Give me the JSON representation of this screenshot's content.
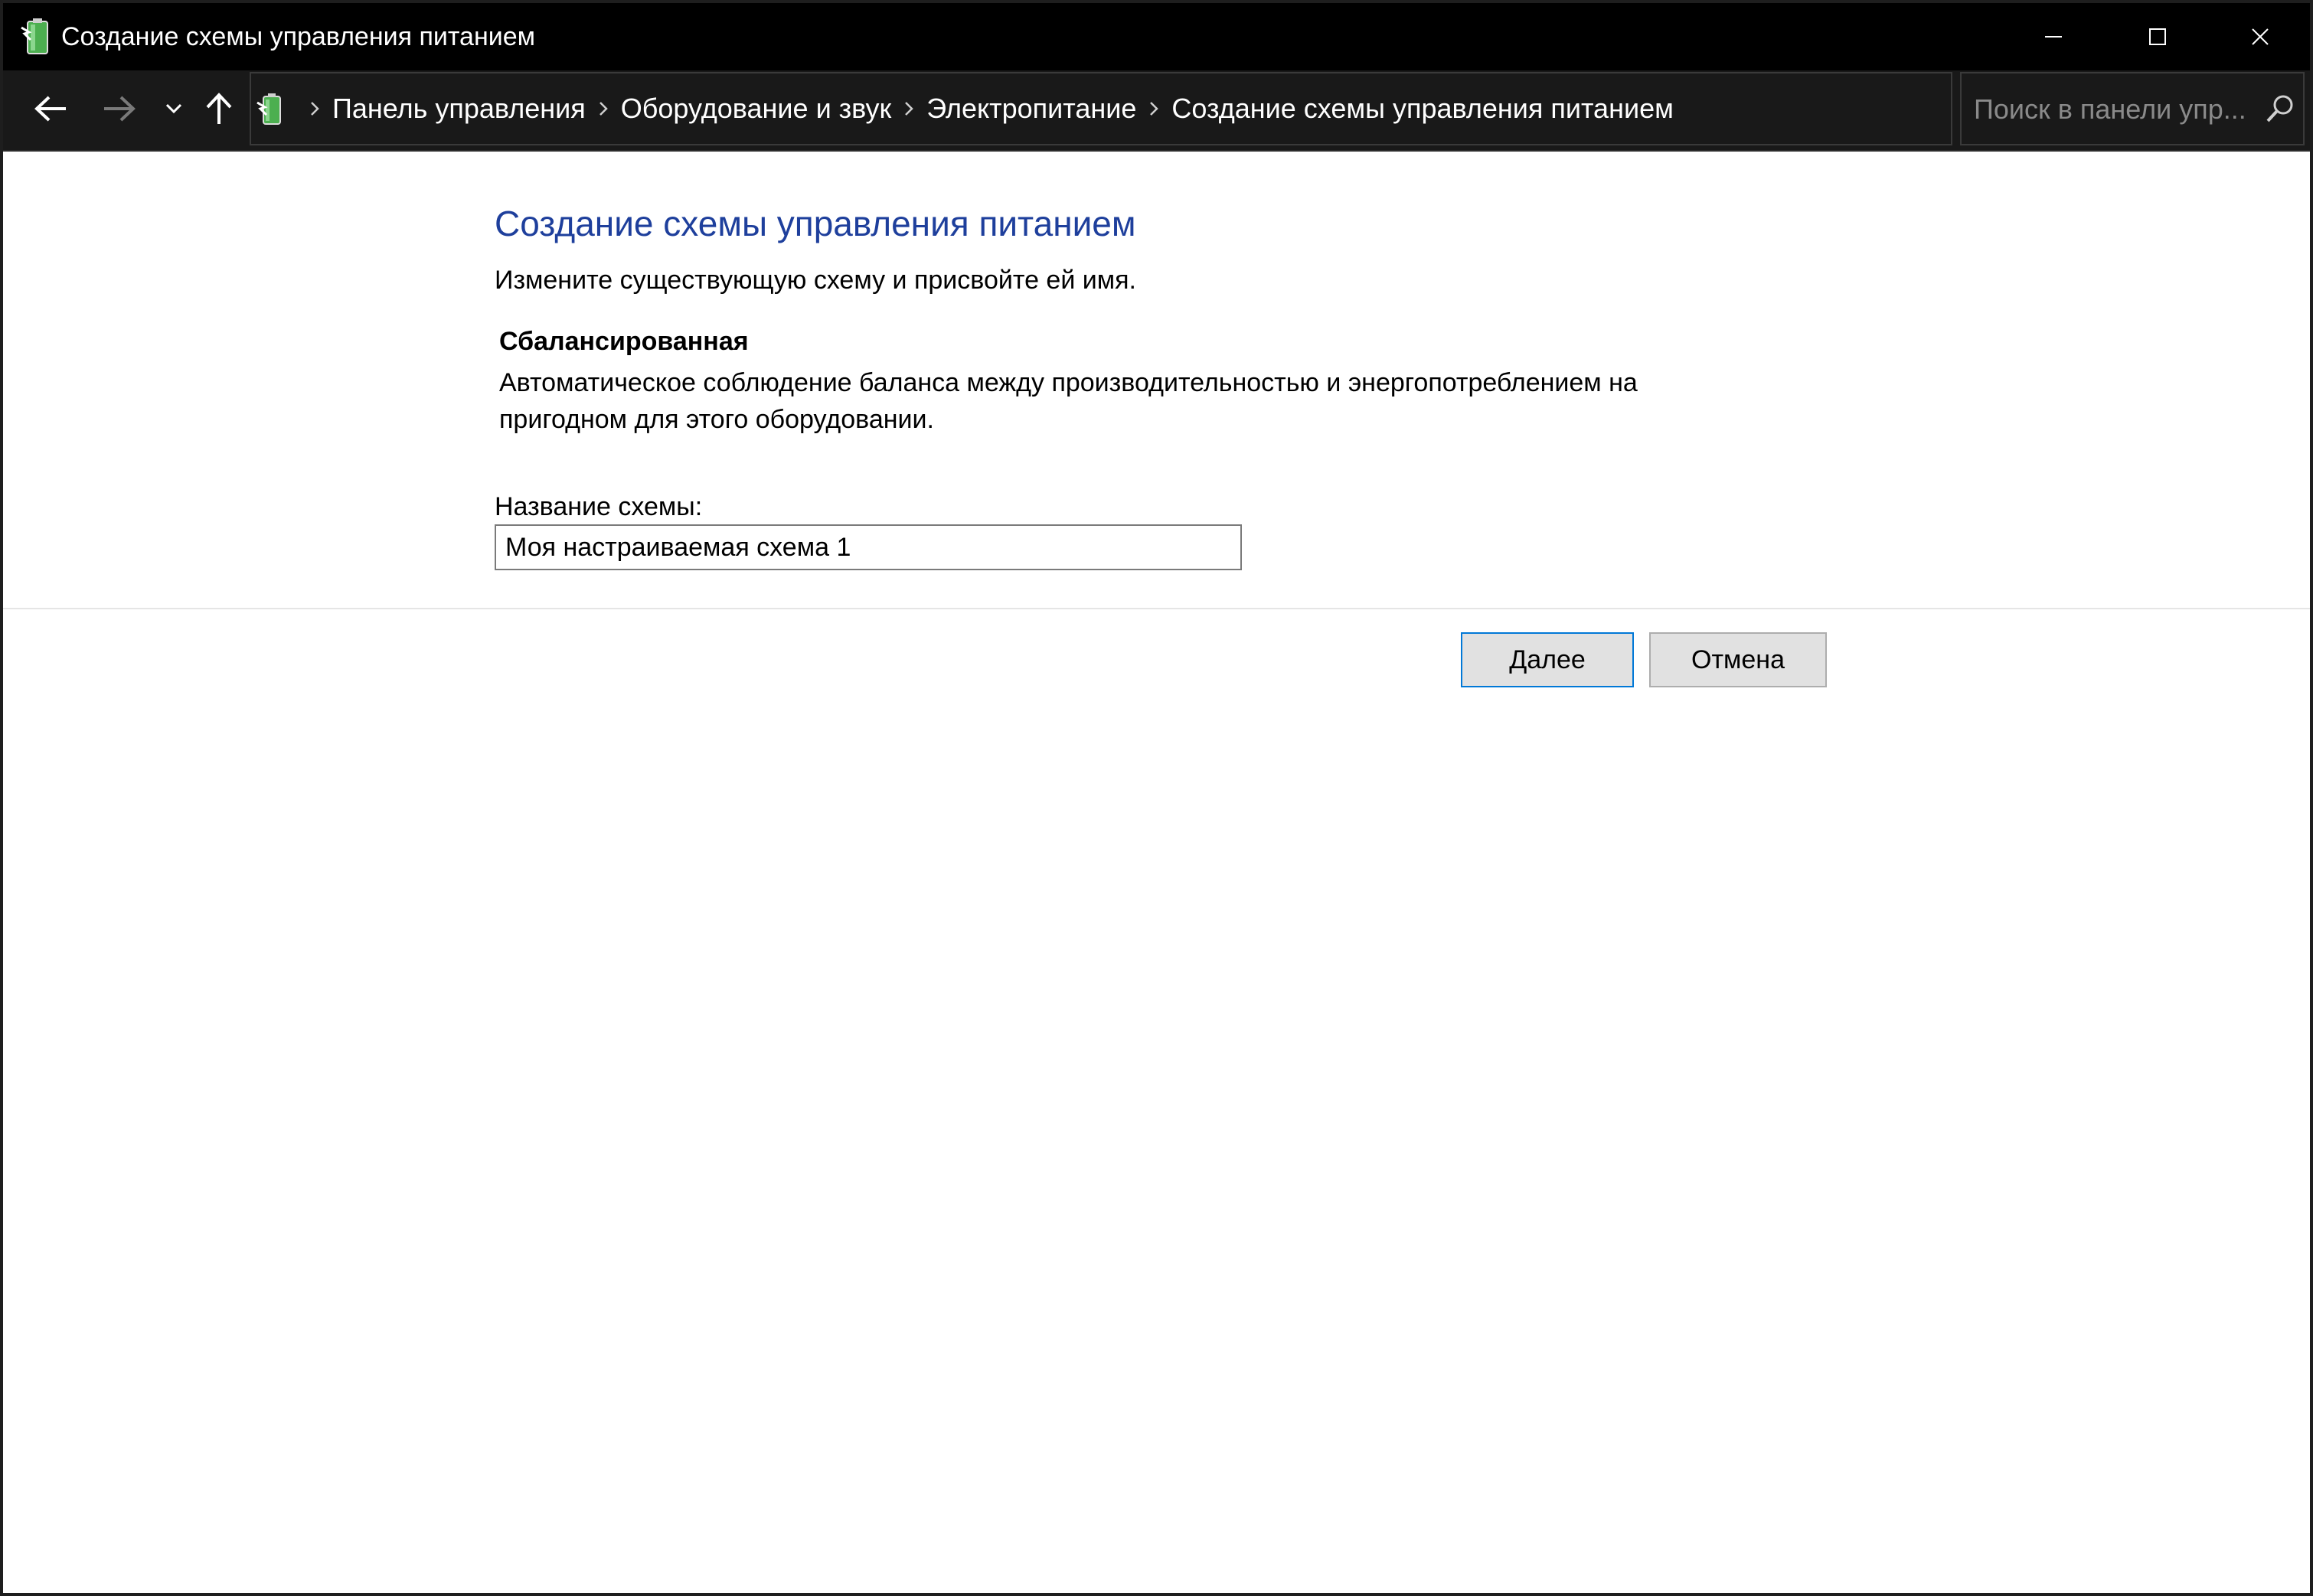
{
  "window": {
    "title": "Создание схемы управления питанием",
    "buttons": {
      "minimize": "minimize-icon",
      "maximize": "maximize-icon",
      "close": "close-icon"
    }
  },
  "nav": {
    "back": "back-arrow-icon",
    "forward": "forward-arrow-icon",
    "recent": "chevron-down-icon",
    "up": "up-arrow-icon"
  },
  "breadcrumb": {
    "items": [
      {
        "label": "Панель управления"
      },
      {
        "label": "Оборудование и звук"
      },
      {
        "label": "Электропитание"
      },
      {
        "label": "Создание схемы управления питанием"
      }
    ]
  },
  "search": {
    "placeholder": "Поиск в панели упр..."
  },
  "content": {
    "title": "Создание схемы управления питанием",
    "subtitle": "Измените существующую схему и присвойте ей имя.",
    "plan_name": "Сбалансированная",
    "plan_description": "Автоматическое соблюдение баланса между производительностью и энергопотреблением на пригодном для этого оборудовании.",
    "field_label": "Название схемы:",
    "field_value": "Моя настраиваемая схема 1"
  },
  "buttons": {
    "next": "Далее",
    "cancel": "Отмена"
  },
  "colors": {
    "title_blue": "#1e3f9c",
    "titlebar_bg": "#000000",
    "navbar_bg": "#191919",
    "accent_focus": "#0078d7"
  }
}
